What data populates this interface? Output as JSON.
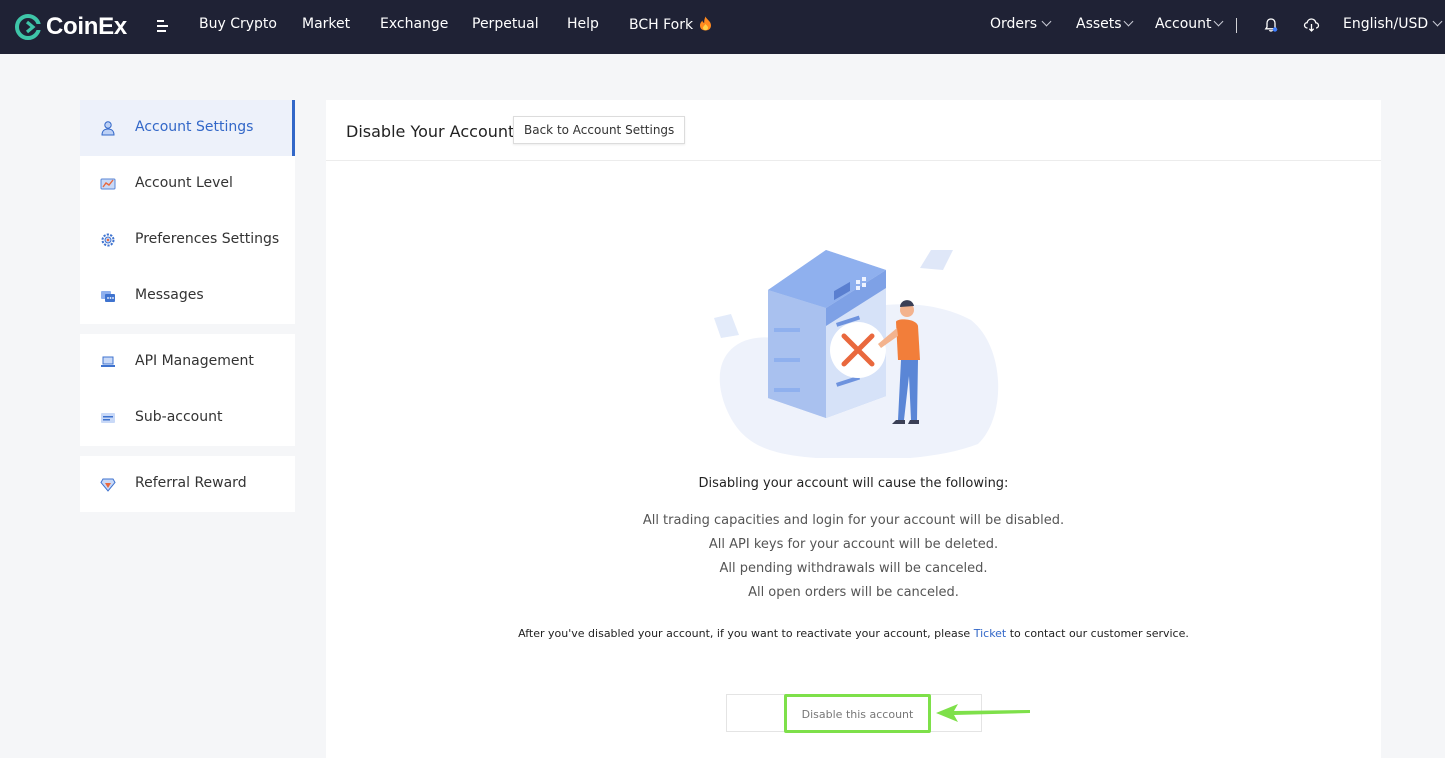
{
  "brand": {
    "name": "CoinEx",
    "color": "#3ec5a8"
  },
  "nav": {
    "left": [
      "Buy Crypto",
      "Market",
      "Exchange",
      "Perpetual",
      "Help",
      "BCH Fork"
    ],
    "orders": "Orders",
    "assets": "Assets",
    "account": "Account",
    "language": "English/USD"
  },
  "sidebar": {
    "groups": [
      [
        {
          "label": "Account Settings",
          "icon": "user-settings-icon",
          "active": true
        },
        {
          "label": "Account Level",
          "icon": "level-icon"
        },
        {
          "label": "Preferences Settings",
          "icon": "gear-icon"
        },
        {
          "label": "Messages",
          "icon": "message-icon"
        }
      ],
      [
        {
          "label": "API Management",
          "icon": "laptop-icon"
        },
        {
          "label": "Sub-account",
          "icon": "sub-account-icon"
        }
      ],
      [
        {
          "label": "Referral Reward",
          "icon": "diamond-icon"
        }
      ]
    ]
  },
  "main": {
    "title": "Disable Your Account",
    "back_label": "Back to Account Settings",
    "consequences_title": "Disabling your account will cause the following:",
    "consequences": [
      "All trading capacities and login for your account will be disabled.",
      "All API keys for your account will be deleted.",
      "All pending withdrawals will be canceled.",
      "All open orders will be canceled."
    ],
    "reactivate_before": "After you've disabled your account, if you want to reactivate your account, please ",
    "ticket_link": "Ticket",
    "reactivate_after": " to contact our customer service.",
    "disable_label": "Disable this account"
  },
  "colors": {
    "nav_bg": "#1f2235",
    "accent": "#3267c8",
    "highlight": "#7ee04a"
  }
}
